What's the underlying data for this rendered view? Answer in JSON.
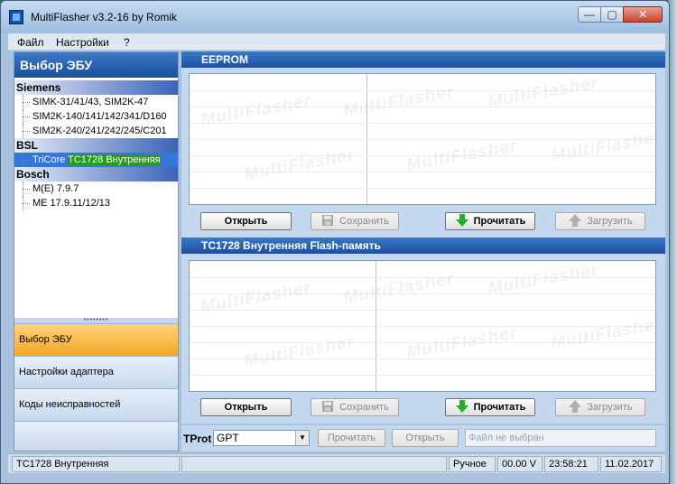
{
  "window": {
    "title": "MultiFlasher v3.2-16 by Romik",
    "minimize_glyph": "—",
    "maximize_glyph": "▢",
    "close_glyph": "✕"
  },
  "menu": [
    "Файл",
    "Настройки",
    "?"
  ],
  "left_panel": {
    "header": "Выбор ЭБУ",
    "groups": [
      {
        "name": "Siemens",
        "items": [
          "SIMK-31/41/43, SIM2K-47",
          "SIM2K-140/141/142/341/D160",
          "SIM2K-240/241/242/245/C201"
        ]
      },
      {
        "name": "BSL",
        "items": []
      },
      {
        "name": "Bosch",
        "items": [
          "M(E) 7.9.7",
          "ME 17.9.11/12/13"
        ]
      }
    ],
    "selected_item": {
      "prefix": "TriCore",
      "highlight": "TC1728 Внутренняя"
    },
    "grip": "••••••••",
    "nav": [
      "Выбор ЭБУ",
      "Настройки адаптера",
      "Коды неисправностей"
    ]
  },
  "eeprom": {
    "title": "EEPROM",
    "watermark": "MultiFlasher",
    "buttons": {
      "open": "Открыть",
      "save": "Сохранить",
      "read": "Прочитать",
      "upload": "Загрузить"
    }
  },
  "flash": {
    "title": "TC1728 Внутренняя Flash-память",
    "watermark": "MultiFlasher",
    "buttons": {
      "open": "Открыть",
      "save": "Сохранить",
      "read": "Прочитать",
      "upload": "Загрузить"
    }
  },
  "tprot": {
    "label": "TProt",
    "selected": "GPT",
    "read": "Прочитать",
    "open": "Открыть",
    "file_status": "Файл не выбран"
  },
  "status": {
    "ecu": "TC1728 Внутренняя",
    "mode": "Ручное",
    "voltage": "00.00 V",
    "time": "23:58:21",
    "date": "11.02.2017"
  },
  "colors": {
    "header_blue": "#1c4f9c",
    "active_nav": "#f6a823",
    "selection": "#3477d8",
    "tree_highlight": "#2a9a1e",
    "read_arrow": "#22b022"
  }
}
